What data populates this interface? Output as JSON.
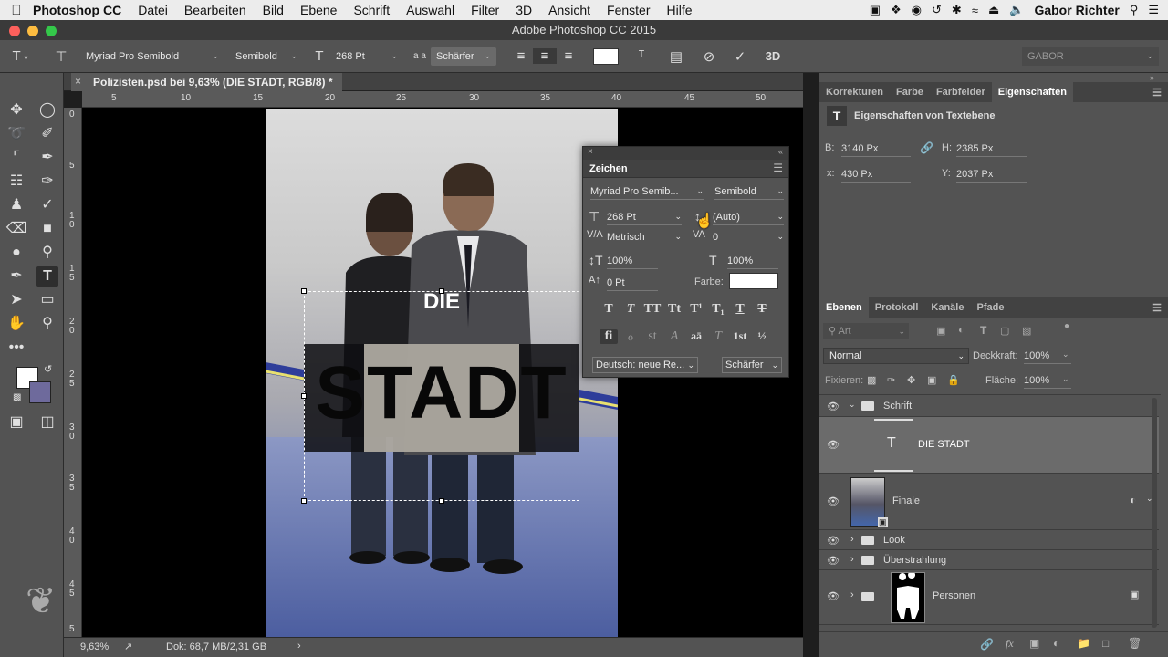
{
  "menubar": {
    "app_name": "Photoshop CC",
    "items": [
      "Datei",
      "Bearbeiten",
      "Bild",
      "Ebene",
      "Schrift",
      "Auswahl",
      "Filter",
      "3D",
      "Ansicht",
      "Fenster",
      "Hilfe"
    ],
    "user": "Gabor Richter"
  },
  "window": {
    "title": "Adobe Photoshop CC 2015"
  },
  "options_bar": {
    "font_family": "Myriad Pro Semibold",
    "font_style": "Semibold",
    "font_size": "268 Pt",
    "antialias_symbol": "a a",
    "antialias": "Schärfer",
    "workspace": "GABOR"
  },
  "document": {
    "tab_title": "Polizisten.psd bei 9,63% (DIE STADT, RGB/8) *",
    "ruler_h": [
      "5",
      "10",
      "15",
      "20",
      "25",
      "30",
      "35",
      "40",
      "45",
      "50"
    ],
    "ruler_v": [
      "0",
      "5",
      "1 0",
      "1 5",
      "2 0",
      "2 5",
      "3 0",
      "3 5",
      "4 0",
      "4 5",
      "5"
    ],
    "canvas_text_small": "DIE",
    "canvas_text_large": "STADT"
  },
  "status_bar": {
    "zoom": "9,63%",
    "doc_info": "Dok: 68,7 MB/2,31 GB"
  },
  "properties_panel": {
    "tabs": [
      "Korrekturen",
      "Farbe",
      "Farbfelder",
      "Eigenschaften"
    ],
    "active_tab": "Eigenschaften",
    "heading": "Eigenschaften von Textebene",
    "b_label": "B:",
    "b_value": "3140 Px",
    "h_label": "H:",
    "h_value": "2385 Px",
    "x_label": "x:",
    "x_value": "430 Px",
    "y_label": "Y:",
    "y_value": "2037 Px"
  },
  "character_panel": {
    "title": "Zeichen",
    "font_family": "Myriad Pro Semib...",
    "font_style": "Semibold",
    "font_size": "268 Pt",
    "leading": "(Auto)",
    "kerning": "Metrisch",
    "tracking": "0",
    "vertical_scale": "100%",
    "horizontal_scale": "100%",
    "baseline_shift": "0 Pt",
    "color_label": "Farbe:",
    "color_value": "#ffffff",
    "style_buttons": [
      "T",
      "T",
      "TT",
      "Tt",
      "T¹",
      "T₁",
      "T",
      "T"
    ],
    "opentype_buttons": [
      "fi",
      "ℴ",
      "st",
      "A",
      "aā",
      "T",
      "1st",
      "½"
    ],
    "language": "Deutsch: neue Re...",
    "antialias": "Schärfer"
  },
  "layers_panel": {
    "tabs": [
      "Ebenen",
      "Protokoll",
      "Kanäle",
      "Pfade"
    ],
    "active_tab": "Ebenen",
    "filter_label": "Art",
    "blend_mode": "Normal",
    "opacity_label": "Deckkraft:",
    "opacity": "100%",
    "lock_label": "Fixieren:",
    "fill_label": "Fläche:",
    "fill": "100%",
    "layers": [
      {
        "name": "Schrift",
        "kind": "group-open"
      },
      {
        "name": "DIE STADT",
        "kind": "text",
        "selected": true
      },
      {
        "name": "Finale",
        "kind": "smart"
      },
      {
        "name": "Look",
        "kind": "group"
      },
      {
        "name": "Überstrahlung",
        "kind": "group"
      },
      {
        "name": "Personen",
        "kind": "group-mask"
      }
    ]
  },
  "colors": {
    "foreground": "#ffffff",
    "background": "#6e6a9c",
    "selected_layer": "#6b6b6b"
  }
}
